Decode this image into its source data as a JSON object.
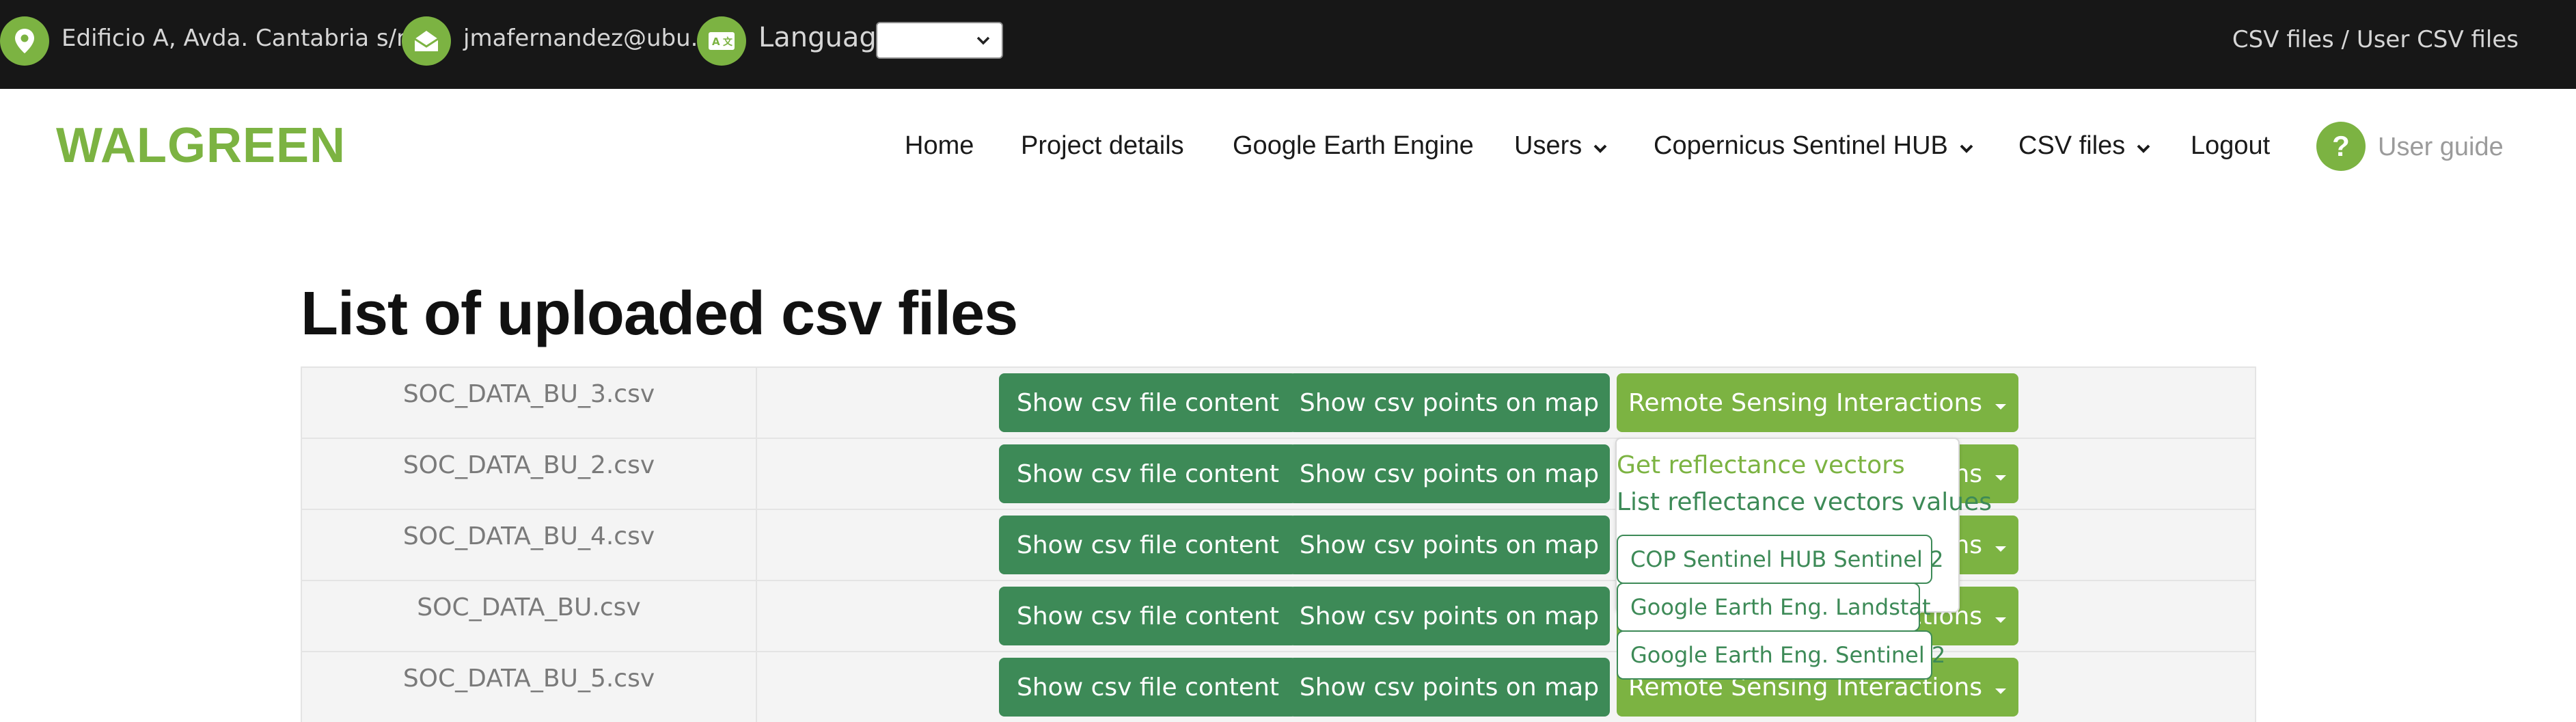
{
  "topbar": {
    "address": "Edificio A, Avda. Cantabria s/n",
    "email": "jmafernandez@ubu.es",
    "language_label": "Language:",
    "language_value": "",
    "breadcrumb": "CSV files / User CSV files"
  },
  "nav": {
    "brand": "WALGREEN",
    "items": [
      {
        "label": "Home"
      },
      {
        "label": "Project details"
      },
      {
        "label": "Google Earth Engine"
      },
      {
        "label": "Users"
      },
      {
        "label": "Copernicus Sentinel HUB"
      },
      {
        "label": "CSV files"
      },
      {
        "label": "Logout"
      }
    ],
    "user_guide": "User guide",
    "guide_symbol": "?"
  },
  "main": {
    "title": "List of uploaded csv files",
    "buttons": {
      "content": "Show csv file content",
      "map": "Show csv points on map",
      "remote": "Remote Sensing Interactions"
    },
    "rows": [
      {
        "file": "SOC_DATA_BU_3.csv"
      },
      {
        "file": "SOC_DATA_BU_2.csv"
      },
      {
        "file": "SOC_DATA_BU_4.csv"
      },
      {
        "file": "SOC_DATA_BU.csv"
      },
      {
        "file": "SOC_DATA_BU_5.csv"
      }
    ]
  },
  "dropdown": {
    "get_vectors": "Get reflectance vectors",
    "list_values": "List reflectance vectors values",
    "sub_options": [
      {
        "label": "COP Sentinel HUB Sentinel 2"
      },
      {
        "label": "Google Earth Eng. Landstat"
      },
      {
        "label": "Google Earth Eng. Sentinel 2"
      }
    ]
  },
  "colors": {
    "topbar_bg": "#171717",
    "accent_green": "#7cb342",
    "button_dark_green": "#3d8a57"
  },
  "icons": {
    "address": "map-pin-icon",
    "email": "envelope-open-icon",
    "language": "translate-icon",
    "guide": "question-icon"
  }
}
